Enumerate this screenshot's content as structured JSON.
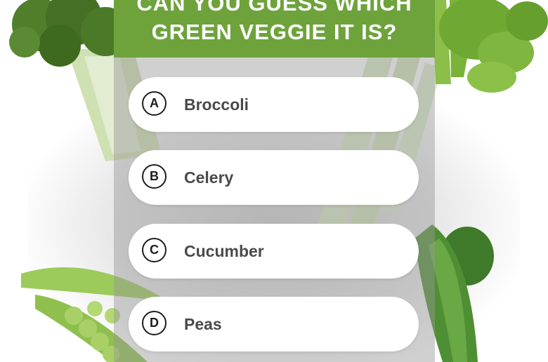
{
  "quiz": {
    "title_line1": "CAN YOU GUESS WHICH",
    "title_line2": "GREEN VEGGIE IT IS?",
    "options": [
      {
        "letter": "A",
        "label": "Broccoli"
      },
      {
        "letter": "B",
        "label": "Celery"
      },
      {
        "letter": "C",
        "label": "Cucumber"
      },
      {
        "letter": "D",
        "label": "Peas"
      }
    ]
  },
  "colors": {
    "header_green": "#6ea33c",
    "option_background": "#ffffff",
    "option_text": "#4a4a4a",
    "letter_outline": "#1c1c1c"
  },
  "images": [
    "broccoli",
    "celery",
    "peas",
    "cucumber"
  ]
}
